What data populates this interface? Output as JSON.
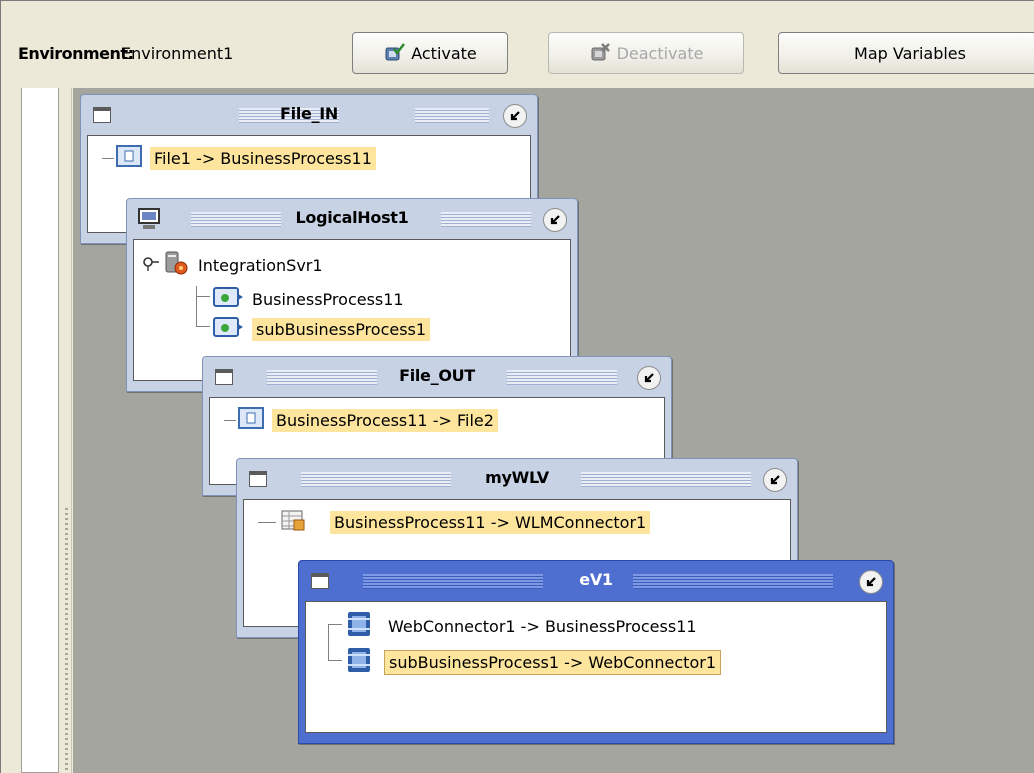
{
  "toolbar": {
    "environment_label": "Environment:",
    "environment_value": "Environment1",
    "activate_label": "Activate",
    "deactivate_label": "Deactivate",
    "map_variables_label": "Map Variables"
  },
  "windows": {
    "file_in": {
      "title": "File_IN",
      "rows": [
        "File1 -> BusinessProcess11"
      ]
    },
    "logicalhost": {
      "title": "LogicalHost1",
      "server": "IntegrationSvr1",
      "rows": [
        "BusinessProcess11",
        "subBusinessProcess1"
      ]
    },
    "file_out": {
      "title": "File_OUT",
      "rows": [
        "BusinessProcess11 -> File2"
      ]
    },
    "mywlv": {
      "title": "myWLV",
      "rows": [
        "BusinessProcess11 -> WLMConnector1"
      ]
    },
    "ev1": {
      "title": "eV1",
      "rows": [
        "WebConnector1 -> BusinessProcess11",
        "subBusinessProcess1 -> WebConnector1"
      ]
    }
  },
  "colors": {
    "highlight": "#fde59e",
    "window_inactive": "#c7d2e5",
    "window_active": "#4f6fd0",
    "canvas": "#a5a5a0"
  }
}
